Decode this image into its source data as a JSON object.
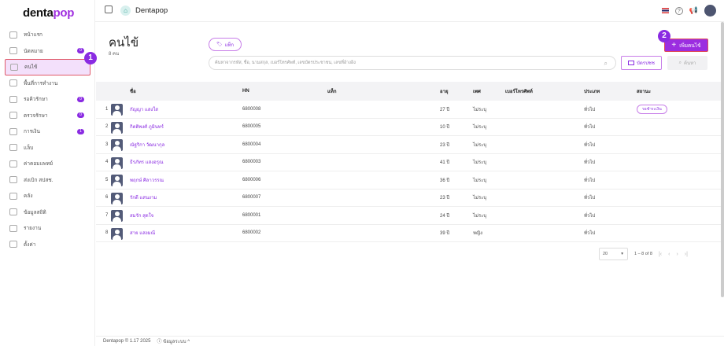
{
  "app": {
    "logo_a": "denta",
    "logo_b": "pop",
    "brand": "Dentapop"
  },
  "sidebar": {
    "items": [
      {
        "label": "หน้าแรก",
        "icon": "home-icon"
      },
      {
        "label": "นัดหมาย",
        "icon": "calendar-icon",
        "badge": "0"
      },
      {
        "label": "คนไข้",
        "icon": "user-icon",
        "active": true
      },
      {
        "label": "พื้นที่การทำงาน",
        "icon": "workspace-icon"
      },
      {
        "label": "รอคิวรักษา",
        "icon": "queue-icon",
        "badge": "0"
      },
      {
        "label": "ตรวจรักษา",
        "icon": "tools-icon",
        "badge": "0"
      },
      {
        "label": "การเงิน",
        "icon": "money-icon",
        "badge": "1"
      },
      {
        "label": "แล็บ",
        "icon": "tooth-icon"
      },
      {
        "label": "ค่าคอมแพทย์",
        "icon": "percent-icon"
      },
      {
        "label": "ส่งเบิก สปสช.",
        "icon": "cloud-icon"
      },
      {
        "label": "คลัง",
        "icon": "box-icon"
      },
      {
        "label": "ข้อมูลสถิติ",
        "icon": "stats-icon"
      },
      {
        "label": "รายงาน",
        "icon": "report-icon"
      },
      {
        "label": "ตั้งค่า",
        "icon": "gear-icon"
      }
    ]
  },
  "markers": {
    "m1": "1",
    "m2": "2"
  },
  "page": {
    "title": "คนไข้",
    "count": "8 คน",
    "tag_button": "แท็ก",
    "search_placeholder": "ค้นหาจากรหัส, ชื่อ, นามสกุล, เบอร์โทรศัพท์, เลขบัตรประชาชน, เลขที่อ้างอิง",
    "add_button": "เพิ่มคนไข้",
    "id_card_button": "บัตรปชช",
    "find_button": "ค้นหา"
  },
  "table": {
    "headers": {
      "name": "ชื่อ",
      "hn": "HN",
      "tag": "แท็ก",
      "age": "อายุ",
      "sex": "เพศ",
      "phone": "เบอร์โทรศัพท์",
      "type": "ประเภท",
      "status": "สถานะ"
    },
    "rows": [
      {
        "no": "1",
        "name": "กัญญา แสงใส",
        "hn": "6800008",
        "age": "27 ปี",
        "sex": "ไม่ระบุ",
        "type": "ทั่วไป",
        "status": "รอชำระเงิน"
      },
      {
        "no": "2",
        "name": "กิตติพงศ์ ภูมินทร์",
        "hn": "6800005",
        "age": "10 ปี",
        "sex": "ไม่ระบุ",
        "type": "ทั่วไป"
      },
      {
        "no": "3",
        "name": "ณัฐริกา วัฒนากุล",
        "hn": "6800004",
        "age": "23 ปี",
        "sex": "ไม่ระบุ",
        "type": "ทั่วไป"
      },
      {
        "no": "4",
        "name": "ธีรภัทร แสงอรุณ",
        "hn": "6800003",
        "age": "41 ปี",
        "sex": "ไม่ระบุ",
        "type": "ทั่วไป"
      },
      {
        "no": "5",
        "name": "พฤกษ์ ศิลาวรรณ",
        "hn": "6800006",
        "age": "36 ปี",
        "sex": "ไม่ระบุ",
        "type": "ทั่วไป"
      },
      {
        "no": "6",
        "name": "รักดี แสนงาม",
        "hn": "6800007",
        "age": "23 ปี",
        "sex": "ไม่ระบุ",
        "type": "ทั่วไป"
      },
      {
        "no": "7",
        "name": "สมรัก สุดใจ",
        "hn": "6800001",
        "age": "24 ปี",
        "sex": "ไม่ระบุ",
        "type": "ทั่วไป"
      },
      {
        "no": "8",
        "name": "สาย แสงมณี",
        "hn": "6800002",
        "age": "39 ปี",
        "sex": "หญิง",
        "type": "ทั่วไป"
      }
    ]
  },
  "pagination": {
    "per_page": "20",
    "range": "1 – 8 of 8"
  },
  "footer": {
    "version": "Dentapop © 1.17 2025",
    "info": "ข้อมูลระบบ ^"
  }
}
